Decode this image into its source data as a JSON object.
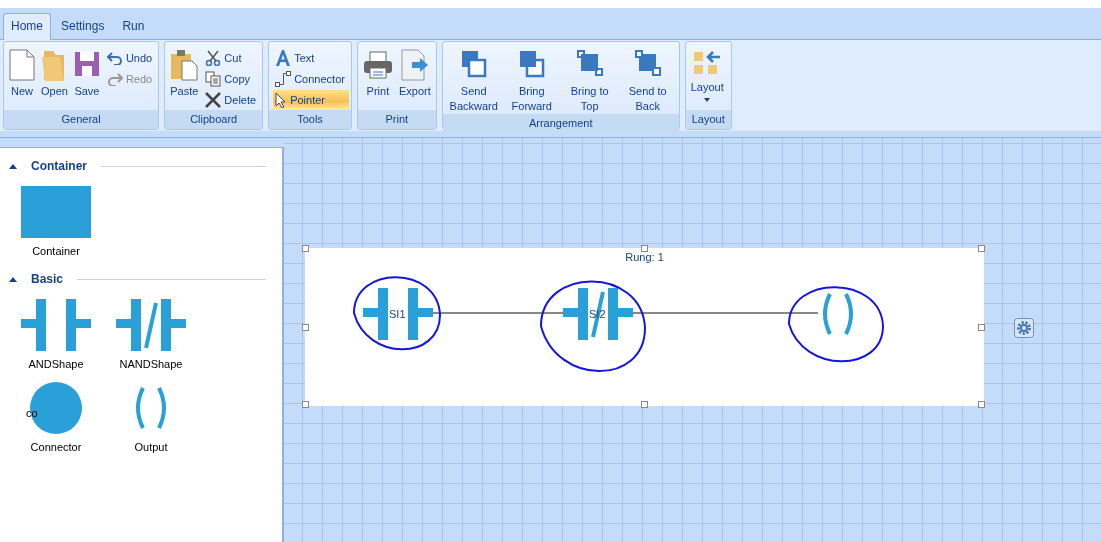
{
  "tabs": [
    {
      "label": "Home",
      "selected": true
    },
    {
      "label": "Settings",
      "selected": false
    },
    {
      "label": "Run",
      "selected": false
    }
  ],
  "ribbon": {
    "groups": [
      {
        "label": "General",
        "items": [
          {
            "label": "New",
            "kind": "large",
            "disabled": false
          },
          {
            "label": "Open",
            "kind": "large",
            "disabled": false
          },
          {
            "label": "Save",
            "kind": "large",
            "disabled": false
          },
          {
            "label": "Undo",
            "kind": "small",
            "disabled": false
          },
          {
            "label": "Redo",
            "kind": "small",
            "disabled": true
          }
        ]
      },
      {
        "label": "Clipboard",
        "items": [
          {
            "label": "Paste",
            "kind": "large",
            "disabled": false
          },
          {
            "label": "Cut",
            "kind": "small",
            "disabled": false
          },
          {
            "label": "Copy",
            "kind": "small",
            "disabled": false
          },
          {
            "label": "Delete",
            "kind": "small",
            "disabled": false
          }
        ]
      },
      {
        "label": "Tools",
        "items": [
          {
            "label": "Text",
            "kind": "small",
            "selected": false
          },
          {
            "label": "Connector",
            "kind": "small",
            "selected": false
          },
          {
            "label": "Pointer",
            "kind": "small",
            "selected": true
          }
        ]
      },
      {
        "label": "Print",
        "items": [
          {
            "label": "Print",
            "kind": "large",
            "disabled": false
          },
          {
            "label": "Export",
            "kind": "large",
            "disabled": false
          }
        ]
      },
      {
        "label": "Arrangement",
        "items": [
          {
            "label": "Send Backward",
            "kind": "large",
            "disabled": false
          },
          {
            "label": "Bring Forward",
            "kind": "large",
            "disabled": false
          },
          {
            "label": "Bring to Top",
            "kind": "large",
            "disabled": false
          },
          {
            "label": "Send to Back",
            "kind": "large",
            "disabled": false
          }
        ]
      },
      {
        "label": "Layout",
        "items": [
          {
            "label": "Layout",
            "kind": "dropdown",
            "disabled": false
          }
        ]
      }
    ]
  },
  "toolbox": {
    "sections": [
      {
        "title": "Container",
        "expanded": true,
        "items": [
          {
            "label": "Container",
            "kind": "rect"
          }
        ]
      },
      {
        "title": "Basic",
        "expanded": true,
        "items": [
          {
            "label": "ANDShape",
            "kind": "and"
          },
          {
            "label": "NANDShape",
            "kind": "nand"
          },
          {
            "label": "Connector",
            "kind": "circle",
            "overlay_label": "co"
          },
          {
            "label": "Output",
            "kind": "output"
          }
        ]
      }
    ]
  },
  "canvas": {
    "rung": {
      "title": "Rung: 1",
      "selected": true,
      "elements": [
        {
          "kind": "and",
          "label": "SI1"
        },
        {
          "kind": "nand",
          "label": "SI2"
        },
        {
          "kind": "output"
        }
      ]
    }
  }
}
